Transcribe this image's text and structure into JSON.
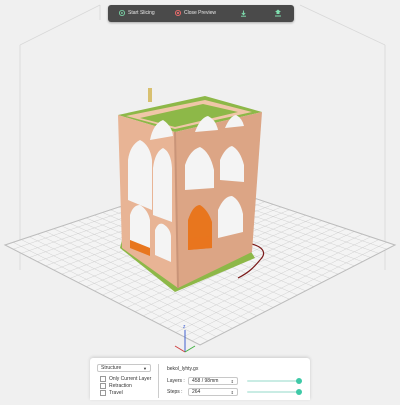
{
  "toolbar": {
    "start_slicing_label": "Start Slicing",
    "close_preview_label": "Close Preview",
    "download_icon": "download-icon",
    "export_icon": "export-icon"
  },
  "panel": {
    "view_mode": "Structure",
    "options": [
      {
        "label": "Only Current Layer"
      },
      {
        "label": "Retraction"
      },
      {
        "label": "Travel"
      }
    ],
    "file_name": "bekol_lyhty.gx",
    "layers_label": "Layers :",
    "layers_value": "458 / 98mm",
    "steps_label": "Steps :",
    "steps_value": "264",
    "layers_slider_fraction": 1.0,
    "steps_slider_fraction": 1.0
  },
  "colors": {
    "toolbar_bg": "#4a4a4a",
    "accent": "#3ec9a7",
    "wall": "#e8b495",
    "skin": "#8db848",
    "infill": "#e8761e"
  }
}
